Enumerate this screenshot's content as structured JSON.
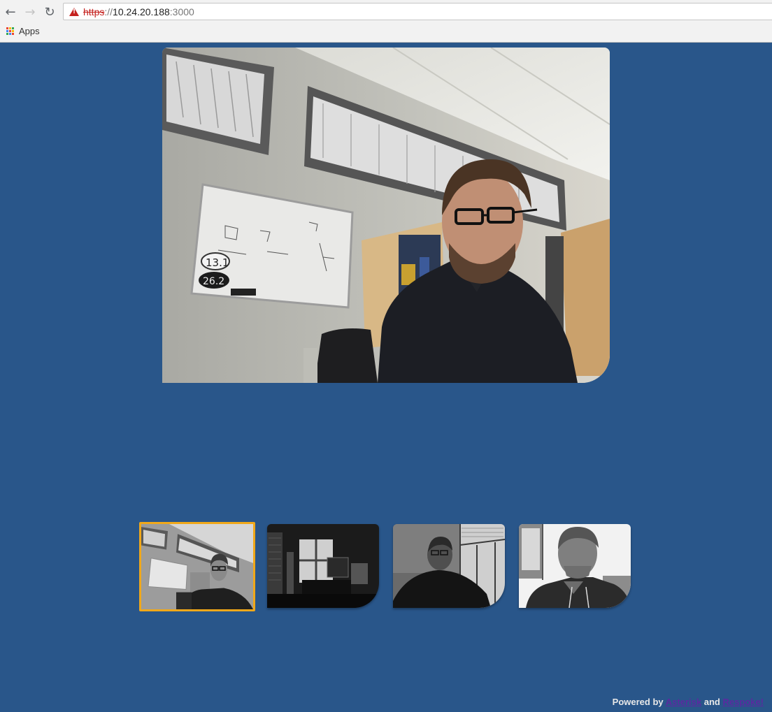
{
  "browser": {
    "url_scheme": "https",
    "url_separator": "://",
    "url_host": "10.24.20.188",
    "url_port": ":3000",
    "bookmarks": [
      {
        "label": "Apps"
      }
    ]
  },
  "participants": {
    "selected_index": 0,
    "accent_color": "#f0a81a"
  },
  "footer": {
    "prefix": "Powered by",
    "link1": "Asterisk",
    "conjunction": "and",
    "link2": "Respoke!"
  },
  "colors": {
    "page_background": "#29568a",
    "selection_border": "#f0a81a",
    "link": "#5a2aa0",
    "insecure_warning": "#c5221f"
  }
}
